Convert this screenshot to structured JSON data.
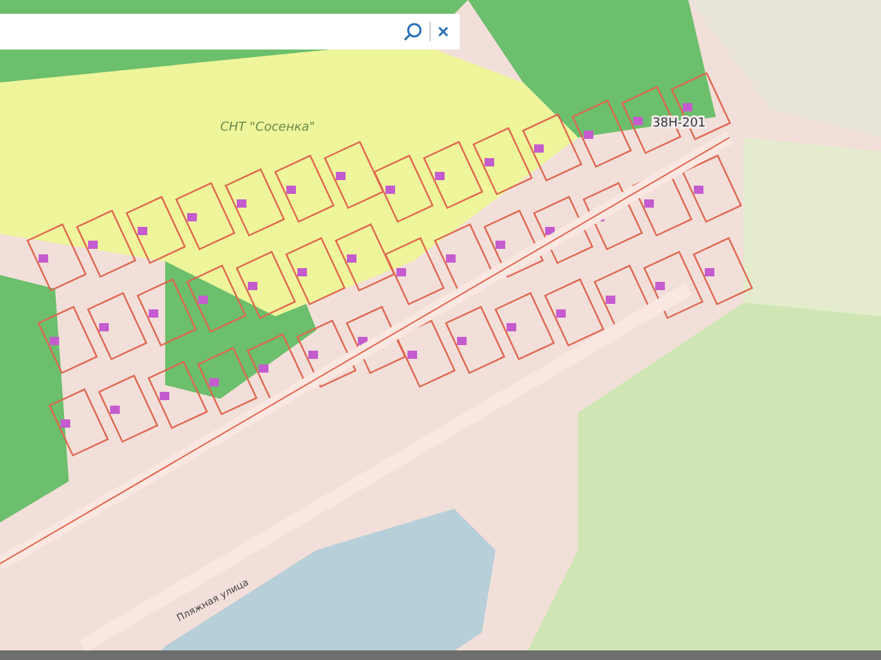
{
  "map_labels": [
    {
      "text": "СНТ \"Сосенка\""
    },
    {
      "text": "38Н-201"
    },
    {
      "text": "Пляжная улица"
    }
  ]
}
